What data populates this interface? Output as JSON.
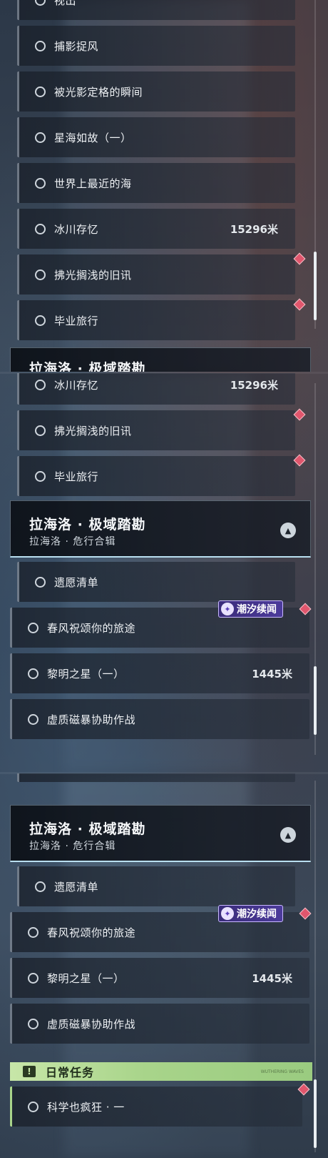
{
  "quests": {
    "capture_wind": "捕影捉风",
    "frozen_moment": "被光影定格的瞬间",
    "sea_of_stars": "星海如故（一）",
    "nearest_sea": "世界上最近的海",
    "glacier_memory": "冰川存忆",
    "glacier_distance": "15296米",
    "old_news": "拂光搁浅的旧讯",
    "graduation_trip": "毕业旅行",
    "wish_list": "遗愿清单",
    "spring_wind": "春风祝颂你的旅途",
    "dawn_star": "黎明之星（一）",
    "dawn_distance": "1445米",
    "magnetic_storm": "虚质磁暴协助作战",
    "science_mad": "科学也疯狂 · 一"
  },
  "region": {
    "title": "拉海洛 · 极域踏勘",
    "subtitle": "拉海洛 · 危行合辑",
    "cut_title": "拉海洛 · 极域踏勘",
    "collapse_icon": "chevron-up-icon"
  },
  "event_badge": {
    "label": "潮汐续闻",
    "icon": "tide-event-icon",
    "color": "#4c3b9b"
  },
  "daily": {
    "label": "日常任务",
    "icon_glyph": "!",
    "note": "WUTHERING WAVES"
  },
  "colors": {
    "tracker_diamond": "#e0566d",
    "daily_accent": "#a8d48a",
    "header_border": "#b9dff0"
  }
}
